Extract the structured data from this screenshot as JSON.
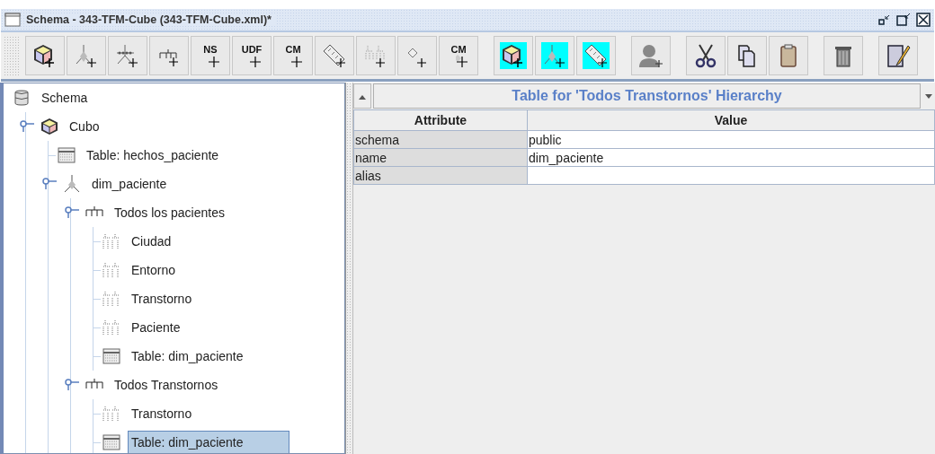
{
  "window": {
    "title": "Schema - 343-TFM-Cube (343-TFM-Cube.xml)*"
  },
  "toolbar": [
    {
      "kind": "cube",
      "highlighted": false
    },
    {
      "kind": "dimension",
      "highlighted": false
    },
    {
      "kind": "dimension-usage",
      "highlighted": false
    },
    {
      "kind": "hierarchy",
      "highlighted": false
    },
    {
      "kind": "text",
      "label": "NS",
      "highlighted": false
    },
    {
      "kind": "text",
      "label": "UDF",
      "highlighted": false
    },
    {
      "kind": "text",
      "label": "CM",
      "highlighted": false
    },
    {
      "kind": "measure",
      "highlighted": false
    },
    {
      "kind": "level",
      "highlighted": false
    },
    {
      "kind": "property",
      "highlighted": false
    },
    {
      "kind": "text-diamond",
      "label": "CM",
      "highlighted": false
    },
    {
      "kind": "separator"
    },
    {
      "kind": "cube",
      "highlighted": true
    },
    {
      "kind": "dimension",
      "highlighted": true
    },
    {
      "kind": "measure",
      "highlighted": true
    },
    {
      "kind": "separator"
    },
    {
      "kind": "user",
      "highlighted": false
    },
    {
      "kind": "separator"
    },
    {
      "kind": "cut",
      "highlighted": false
    },
    {
      "kind": "copy",
      "highlighted": false
    },
    {
      "kind": "paste",
      "highlighted": false
    },
    {
      "kind": "separator"
    },
    {
      "kind": "delete",
      "highlighted": false
    },
    {
      "kind": "separator"
    },
    {
      "kind": "edit",
      "highlighted": false
    }
  ],
  "tree": [
    {
      "kind": "schema",
      "label": "Schema",
      "selected": false,
      "children": [
        {
          "kind": "cube",
          "label": "Cubo",
          "selected": false,
          "expanded": true,
          "children": [
            {
              "kind": "table",
              "label": "Table: hechos_paciente",
              "selected": false
            },
            {
              "kind": "dimension",
              "label": "dim_paciente",
              "selected": false,
              "expanded": true,
              "children": [
                {
                  "kind": "hierarchy",
                  "label": "Todos los pacientes",
                  "selected": false,
                  "expanded": true,
                  "children": [
                    {
                      "kind": "level",
                      "label": "Ciudad",
                      "selected": false
                    },
                    {
                      "kind": "level",
                      "label": "Entorno",
                      "selected": false
                    },
                    {
                      "kind": "level",
                      "label": "Transtorno",
                      "selected": false
                    },
                    {
                      "kind": "level",
                      "label": "Paciente",
                      "selected": false
                    },
                    {
                      "kind": "table",
                      "label": "Table: dim_paciente",
                      "selected": false
                    }
                  ]
                },
                {
                  "kind": "hierarchy",
                  "label": "Todos Transtornos",
                  "selected": false,
                  "expanded": true,
                  "children": [
                    {
                      "kind": "level",
                      "label": "Transtorno",
                      "selected": false
                    },
                    {
                      "kind": "table",
                      "label": "Table: dim_paciente",
                      "selected": true
                    }
                  ]
                }
              ]
            }
          ]
        }
      ]
    }
  ],
  "details": {
    "title": "Table for 'Todos Transtornos' Hierarchy",
    "columns": [
      "Attribute",
      "Value"
    ],
    "rows": [
      [
        "schema",
        "public"
      ],
      [
        "name",
        "dim_paciente"
      ],
      [
        "alias",
        ""
      ]
    ]
  }
}
